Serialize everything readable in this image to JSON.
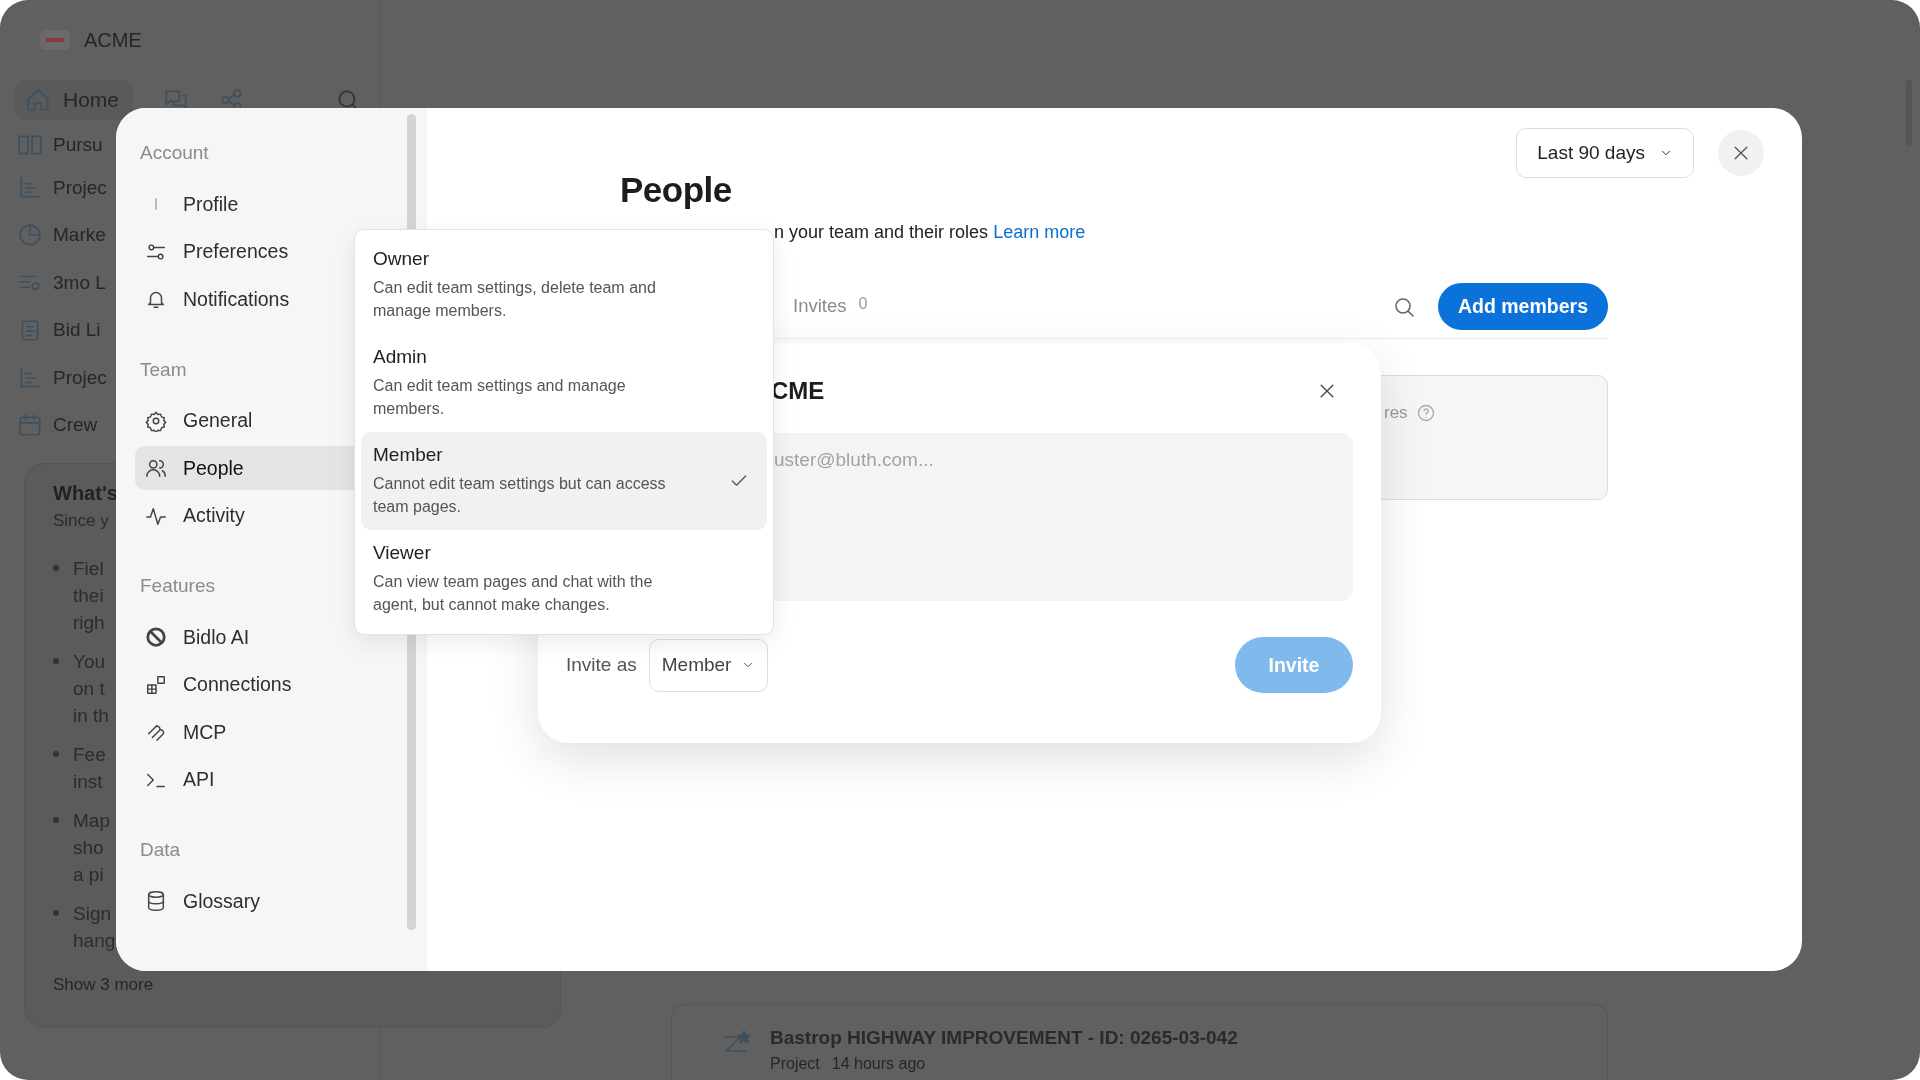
{
  "app": {
    "brand": "ACME",
    "home": "Home",
    "sidebar_items": [
      "Pursu",
      "Projec",
      "Marke",
      "3mo L",
      "Bid Li",
      "Projec",
      "Crew"
    ],
    "whats_new": {
      "title": "What's",
      "subtitle": "Since y",
      "bullets": [
        [
          "Fiel",
          "thei",
          "righ"
        ],
        [
          "You",
          "on t",
          "in th"
        ],
        [
          "Fee",
          "inst"
        ],
        [
          "Map",
          "sho",
          "a pi"
        ],
        [
          "Sign",
          "hang"
        ]
      ],
      "more": "Show 3 more"
    },
    "recent": {
      "title": "Bastrop HIGHWAY IMPROVEMENT - ID: 0265-03-042",
      "type": "Project",
      "time": "14 hours ago"
    }
  },
  "settings": {
    "sections": [
      {
        "heading": "Account",
        "items": [
          {
            "label": "Profile",
            "selected": false
          },
          {
            "label": "Preferences",
            "selected": false
          },
          {
            "label": "Notifications",
            "selected": false
          }
        ]
      },
      {
        "heading": "Team",
        "items": [
          {
            "label": "General",
            "selected": false
          },
          {
            "label": "People",
            "selected": true
          },
          {
            "label": "Activity",
            "selected": false
          }
        ]
      },
      {
        "heading": "Features",
        "items": [
          {
            "label": "Bidlo AI",
            "selected": false
          },
          {
            "label": "Connections",
            "selected": false
          },
          {
            "label": "MCP",
            "selected": false
          },
          {
            "label": "API",
            "selected": false
          }
        ]
      },
      {
        "heading": "Data",
        "items": [
          {
            "label": "Glossary",
            "selected": false
          }
        ]
      }
    ],
    "page": {
      "title": "People",
      "subtitle": "n your team and their roles",
      "link": "Learn more",
      "range": "Last 90 days",
      "tabs": [
        {
          "label": "Invites",
          "count": "0",
          "selected": false
        }
      ],
      "add_button": "Add members",
      "card_text": "res"
    },
    "invite_dialog": {
      "title": "CME",
      "placeholder": "uster@bluth.com...",
      "invite_as": "Invite as",
      "role": "Member",
      "button": "Invite",
      "button_disabled": true
    },
    "role_menu": [
      {
        "name": "Owner",
        "description": "Can edit team settings, delete team and manage members.",
        "selected": false
      },
      {
        "name": "Admin",
        "description": "Can edit team settings and manage members.",
        "selected": false
      },
      {
        "name": "Member",
        "description": "Cannot edit team settings but can access team pages.",
        "selected": true
      },
      {
        "name": "Viewer",
        "description": "Can view team pages and chat with the agent, but cannot make changes.",
        "selected": false
      }
    ]
  }
}
